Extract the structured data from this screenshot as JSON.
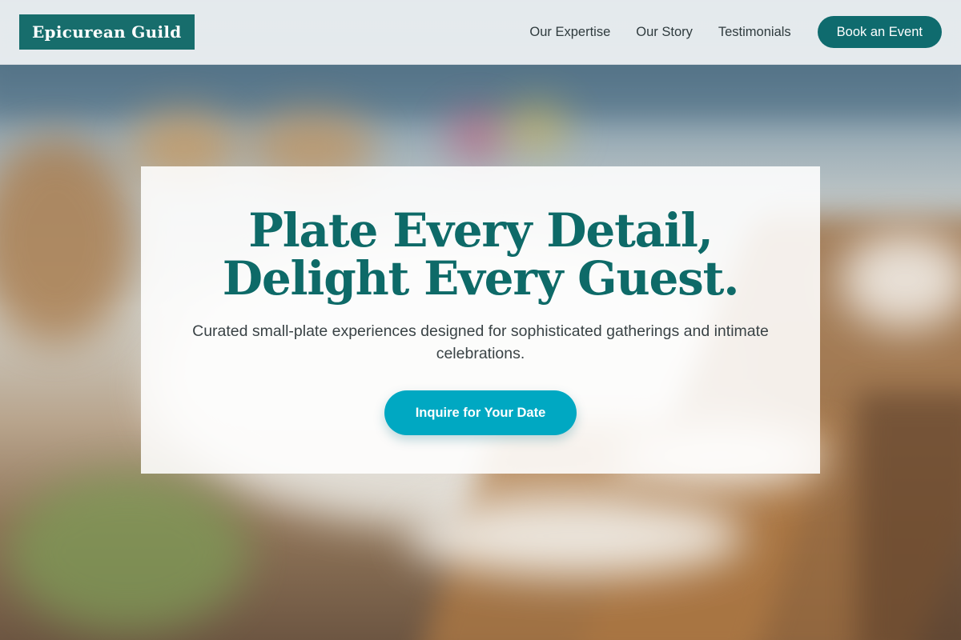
{
  "brand": {
    "name": "Epicurean Guild"
  },
  "nav": {
    "links": [
      "Our Expertise",
      "Our Story",
      "Testimonials"
    ],
    "cta_label": "Book an Event"
  },
  "hero": {
    "title_line1": "Plate Every Detail,",
    "title_line2": "Delight Every Guest.",
    "subtitle": "Curated small-plate experiences designed for sophisticated gatherings and intimate celebrations.",
    "cta_label": "Inquire for Your Date"
  },
  "colors": {
    "brand_teal": "#176d6c",
    "button_teal": "#0f6b6e",
    "cta_cyan": "#00a8c2",
    "title_teal": "#0e6a68"
  }
}
